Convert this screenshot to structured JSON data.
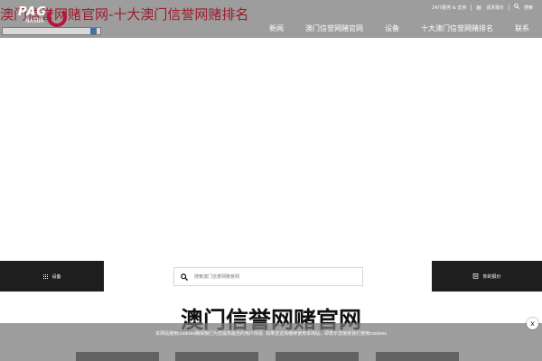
{
  "header": {
    "site_title": "澳门信誉网赌官网-十大澳门信誉网赌排名",
    "logo": {
      "mark": "PAG",
      "sub": "NASBA"
    },
    "util_bar": {
      "support": "24/7服务 & 支持",
      "quote": "请求报价",
      "search": "搜索"
    },
    "nav": [
      {
        "label": "新闻"
      },
      {
        "label": "澳门信誉网赌官网"
      },
      {
        "label": "设备"
      },
      {
        "label": "十大澳门信誉网赌排名"
      },
      {
        "label": "联系"
      }
    ]
  },
  "bar": {
    "equipment_label": "设备",
    "search_placeholder": "搜索澳门信誉网赌官网",
    "quote_label": "你的报价"
  },
  "section": {
    "heading": "澳门信誉网赌官网"
  },
  "cookie": {
    "text": "本网站使用cookies确保我们为您提供最佳的用户体验. 如果您选择继续使用本网站，即表示您接受我们使用cookies",
    "close": "x"
  },
  "colors": {
    "header_bg": "#9d9d9d",
    "title_color": "#9b1b2b",
    "dark_button": "#1e1e1e",
    "brand_red": "#b5173a"
  }
}
